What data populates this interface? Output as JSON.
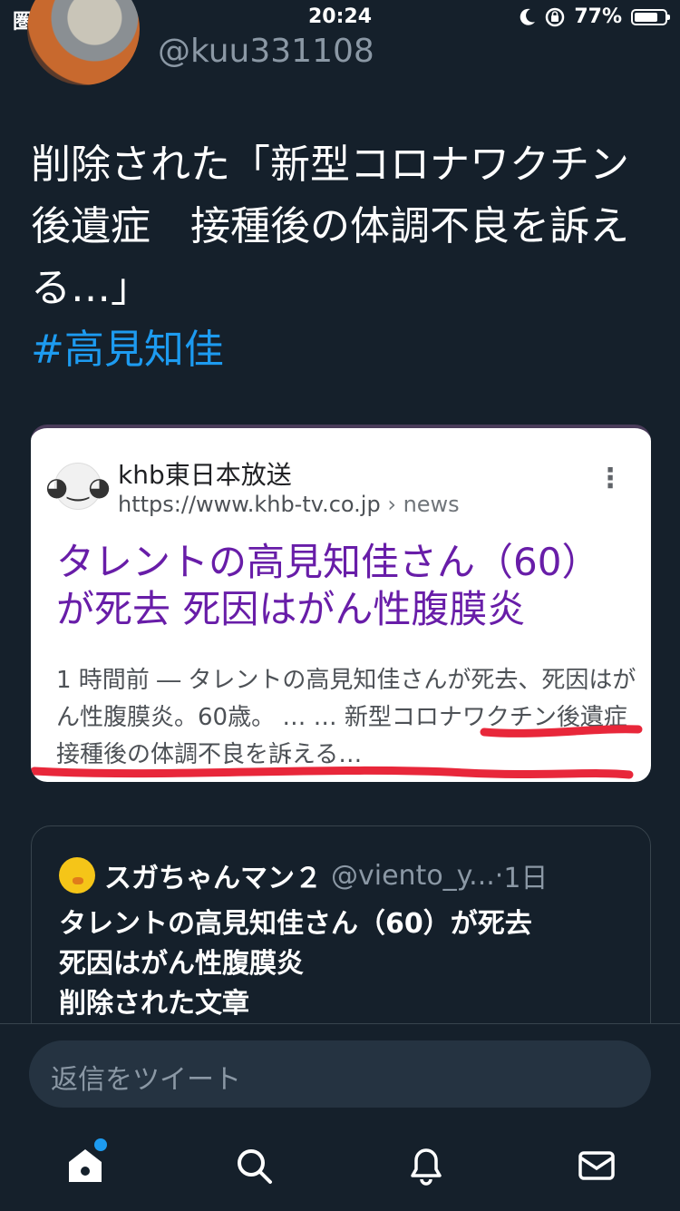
{
  "status_bar": {
    "carrier": "圏外",
    "time": "20:24",
    "battery_percent_label": "77%",
    "battery_level": 0.77
  },
  "tweet": {
    "handle": "@kuu331108",
    "text": "削除された「新型コロナワクチン後遺症　接種後の体調不良を訴える…」",
    "hashtag": "#高見知佳"
  },
  "card": {
    "site_name": "khb東日本放送",
    "url": "https://www.khb-tv.co.jp",
    "url_crumb": " › news",
    "title": "タレントの高見知佳さん（60）が死去 死因はがん性腹膜炎",
    "snippet": "1 時間前 ― タレントの高見知佳さんが死去、死因はがん性腹膜炎。60歳。 … … 新型コロナワクチン後遺症 接種後の体調不良を訴える…",
    "underline_color": "#e8273a"
  },
  "quote": {
    "name": "スガちゃんマン２",
    "handle": "@viento_y...",
    "dot": "·",
    "time": "1日",
    "line1": "タレントの高見知佳さん（60）が死去",
    "line2": "死因はがん性腹膜炎",
    "line3": "削除された文章"
  },
  "reply_bar": {
    "placeholder": "返信をツイート"
  },
  "tab_bar": {
    "items": [
      "home-icon",
      "search-icon",
      "notifications-icon",
      "messages-icon"
    ],
    "accent": "#1d9bf0"
  }
}
